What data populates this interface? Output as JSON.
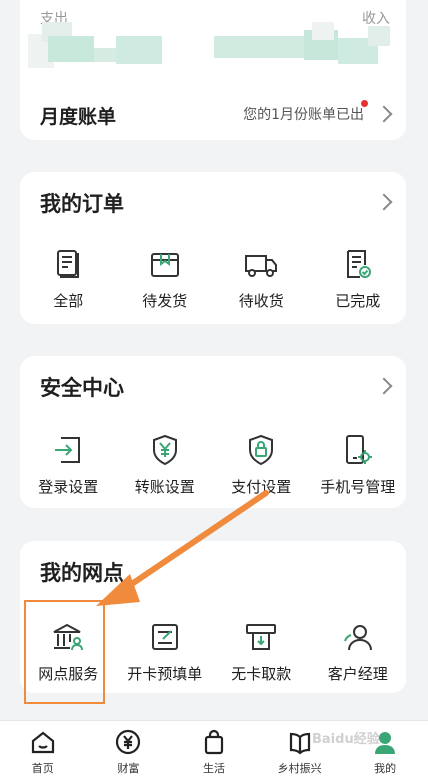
{
  "summary": {
    "expense_label": "支出",
    "income_label": "收入",
    "monthly_bill_label": "月度账单",
    "bill_notice": "您的1月份账单已出"
  },
  "orders": {
    "title": "我的订单",
    "items": [
      {
        "label": "全部",
        "icon": "document-icon"
      },
      {
        "label": "待发货",
        "icon": "package-icon"
      },
      {
        "label": "待收货",
        "icon": "truck-icon"
      },
      {
        "label": "已完成",
        "icon": "completed-doc-icon"
      }
    ]
  },
  "security": {
    "title": "安全中心",
    "items": [
      {
        "label": "登录设置",
        "icon": "login-icon"
      },
      {
        "label": "转账设置",
        "icon": "yuan-shield-icon"
      },
      {
        "label": "支付设置",
        "icon": "lock-shield-icon"
      },
      {
        "label": "手机号管理",
        "icon": "phone-gear-icon"
      }
    ]
  },
  "branch": {
    "title": "我的网点",
    "items": [
      {
        "label": "网点服务",
        "icon": "bank-building-icon"
      },
      {
        "label": "开卡预填单",
        "icon": "form-edit-icon"
      },
      {
        "label": "无卡取款",
        "icon": "atm-withdraw-icon"
      },
      {
        "label": "客户经理",
        "icon": "manager-icon"
      }
    ]
  },
  "tabbar": {
    "items": [
      {
        "label": "首页",
        "icon": "home-icon"
      },
      {
        "label": "财富",
        "icon": "yuan-circle-icon"
      },
      {
        "label": "生活",
        "icon": "shopping-bag-icon"
      },
      {
        "label": "乡村振兴",
        "icon": "book-icon"
      },
      {
        "label": "我的",
        "icon": "profile-icon"
      }
    ],
    "active_index": 4
  },
  "watermark": "Baidu经验",
  "colors": {
    "accent": "#3aa676",
    "highlight": "#f08a3c",
    "notice_dot": "#e5322d"
  }
}
